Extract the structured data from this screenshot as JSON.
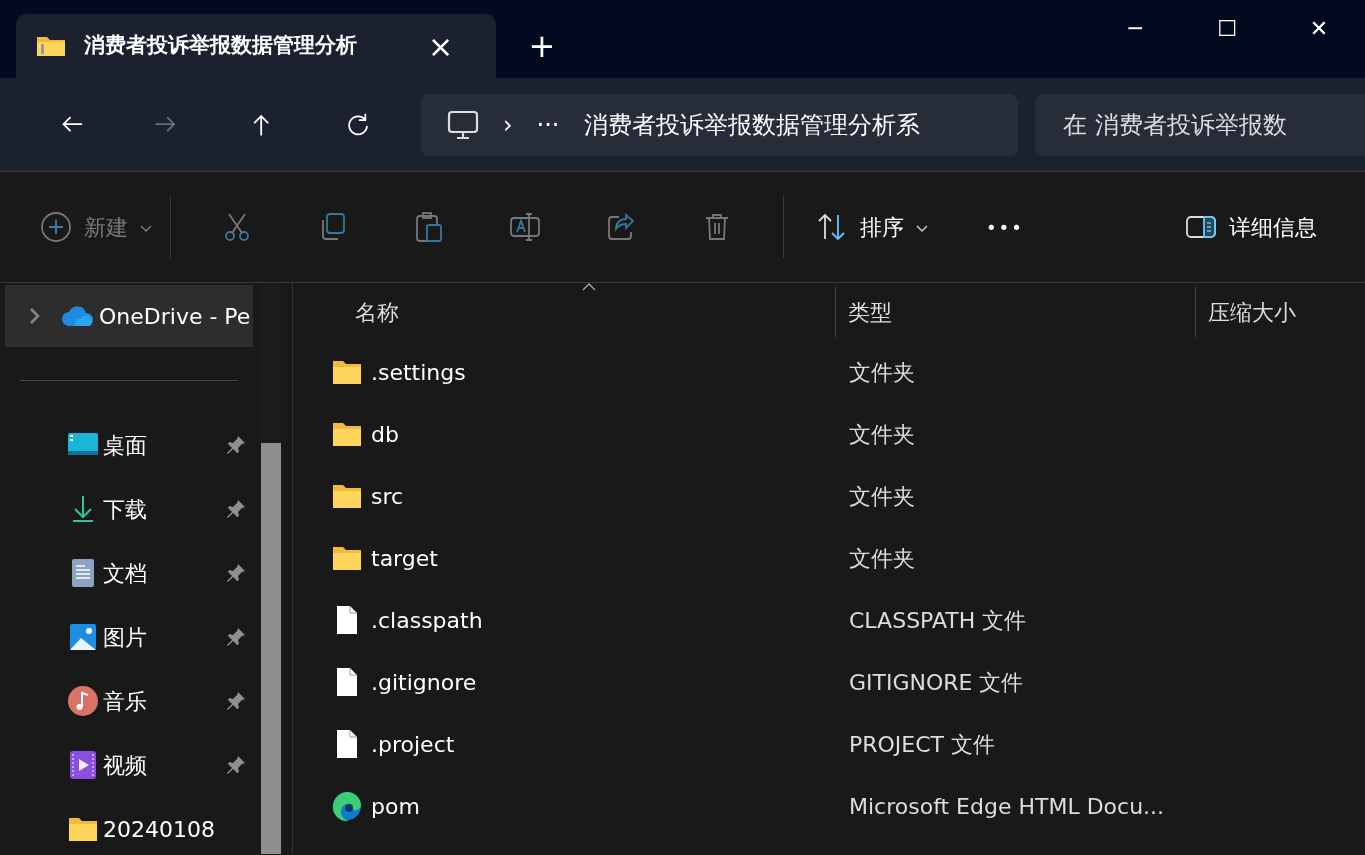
{
  "tab": {
    "title": "消费者投诉举报数据管理分析",
    "close": "×",
    "new_tab": "+"
  },
  "window_controls": [
    "─",
    "☐",
    "✕"
  ],
  "nav_buttons": [
    {
      "disabled": false
    },
    {
      "disabled": true
    },
    {
      "disabled": false
    },
    {
      "disabled": false
    }
  ],
  "address_bar": {
    "separator": "›",
    "ellipsis": "···",
    "path": "消费者投诉举报数据管理分析系"
  },
  "search": {
    "placeholder": "在 消费者投诉举报数"
  },
  "toolbar": {
    "new": {
      "label": "新建",
      "disabled": true
    },
    "actions": [
      {
        "disabled": true
      },
      {
        "disabled": true
      },
      {
        "disabled": true
      },
      {
        "disabled": true
      },
      {
        "disabled": true
      },
      {
        "disabled": true
      }
    ],
    "sort": {
      "label": "排序",
      "disabled": false
    },
    "more": "•••",
    "details": {
      "label": "详细信息",
      "disabled": false
    }
  },
  "sidebar": {
    "onedrive": {
      "label": "OneDrive - Pe",
      "selected": true
    },
    "items": [
      {
        "label": "桌面",
        "pinned": true,
        "selected": false
      },
      {
        "label": "下载",
        "pinned": true,
        "selected": false
      },
      {
        "label": "文档",
        "pinned": true,
        "selected": false
      },
      {
        "label": "图片",
        "pinned": true,
        "selected": false
      },
      {
        "label": "音乐",
        "pinned": true,
        "selected": false
      },
      {
        "label": "视频",
        "pinned": true,
        "selected": false
      },
      {
        "label": "20240108",
        "pinned": false,
        "selected": false
      }
    ]
  },
  "table": {
    "columns": [
      "名称",
      "类型",
      "压缩大小"
    ],
    "rows": [
      {
        "kind": "folder",
        "name": ".settings",
        "type": "文件夹"
      },
      {
        "kind": "folder",
        "name": "db",
        "type": "文件夹"
      },
      {
        "kind": "folder",
        "name": "src",
        "type": "文件夹"
      },
      {
        "kind": "folder",
        "name": "target",
        "type": "文件夹"
      },
      {
        "kind": "file",
        "name": ".classpath",
        "type": "CLASSPATH 文件"
      },
      {
        "kind": "file",
        "name": ".gitignore",
        "type": "GITIGNORE 文件"
      },
      {
        "kind": "file",
        "name": ".project",
        "type": "PROJECT 文件"
      },
      {
        "kind": "edge",
        "name": "pom",
        "type": "Microsoft Edge HTML Docu..."
      }
    ]
  }
}
